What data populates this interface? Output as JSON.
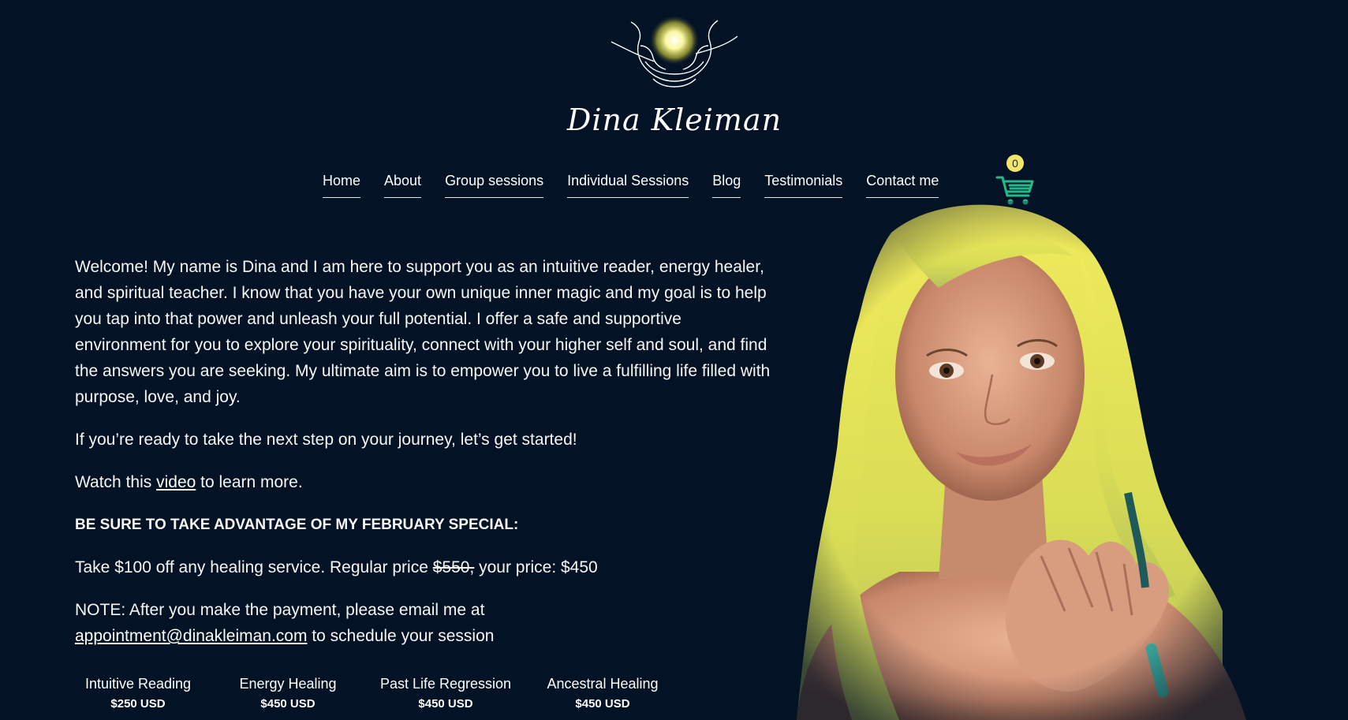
{
  "brand": {
    "name": "Dina Kleiman",
    "logo_icon": "glowing-hands-icon"
  },
  "nav": {
    "items": [
      {
        "label": "Home"
      },
      {
        "label": "About"
      },
      {
        "label": "Group sessions"
      },
      {
        "label": "Individual Sessions"
      },
      {
        "label": "Blog"
      },
      {
        "label": "Testimonials"
      },
      {
        "label": "Contact me"
      }
    ],
    "cart_count": "0",
    "cart_icon": "shopping-cart-icon"
  },
  "content": {
    "intro": "Welcome! My name is Dina and I am here to support you as an intuitive reader, energy healer, and spiritual teacher. I know that you have your own unique inner magic and my goal is to help you tap into that power and unleash your full potential. I offer a safe and supportive environment for you to explore your spirituality, connect with your higher self and soul, and find the answers you are seeking. My ultimate aim is to empower you to live a fulfilling life filled with purpose, love, and joy.",
    "ready": "If you’re ready to take the next step on your journey, let’s get started!",
    "watch_prefix": "Watch this ",
    "watch_link": "video",
    "watch_suffix": " to learn more.",
    "special_heading": "BE SURE TO TAKE ADVANTAGE OF MY FEBRUARY SPECIAL:",
    "offer_prefix": "Take $100 off any healing service. Regular price ",
    "offer_old_price": "$550,",
    "offer_suffix": " your price: $450",
    "note_prefix": "NOTE: After you make the payment, please email me at",
    "note_email": "appointment@dinakleiman.com",
    "note_suffix": " to schedule your session"
  },
  "services": [
    {
      "name": "Intuitive Reading",
      "price": "$250 USD"
    },
    {
      "name": "Energy Healing",
      "price": "$450 USD"
    },
    {
      "name": "Past Life Regression",
      "price": "$450 USD"
    },
    {
      "name": "Ancestral Healing",
      "price": "$450 USD"
    }
  ],
  "colors": {
    "background": "#031224",
    "cart_accent": "#25b98a",
    "badge": "#f2e56c",
    "hair": "#e9e35c"
  }
}
